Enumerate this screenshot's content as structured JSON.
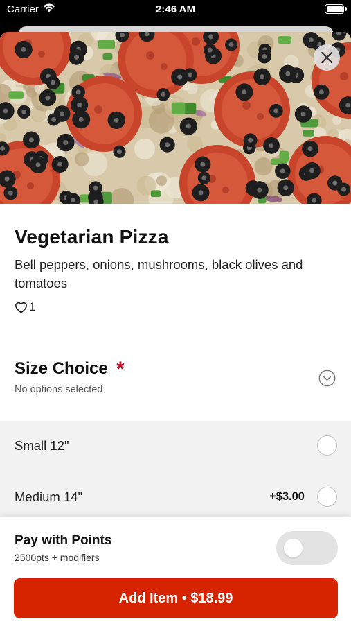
{
  "status_bar": {
    "carrier": "Carrier",
    "time": "2:46 AM",
    "icons": [
      "wifi-icon",
      "battery-icon"
    ]
  },
  "product": {
    "title": "Vegetarian Pizza",
    "description": "Bell peppers, onions, mushrooms, black olives and tomatoes",
    "likes": "1",
    "image_icon": "pizza-photo"
  },
  "size_choice": {
    "title": "Size Choice",
    "required_marker": "*",
    "subtitle": "No options selected",
    "options": [
      {
        "label": "Small 12\"",
        "price": ""
      },
      {
        "label": "Medium 14\"",
        "price": "+$3.00"
      }
    ]
  },
  "pay_with_points": {
    "title": "Pay with Points",
    "subtitle": "2500pts + modifiers",
    "enabled": false
  },
  "add_button": {
    "label": "Add Item • $18.99"
  },
  "colors": {
    "accent_red": "#d62300",
    "required_red": "#c8102e",
    "toggle_off": "#e3e3e3"
  }
}
